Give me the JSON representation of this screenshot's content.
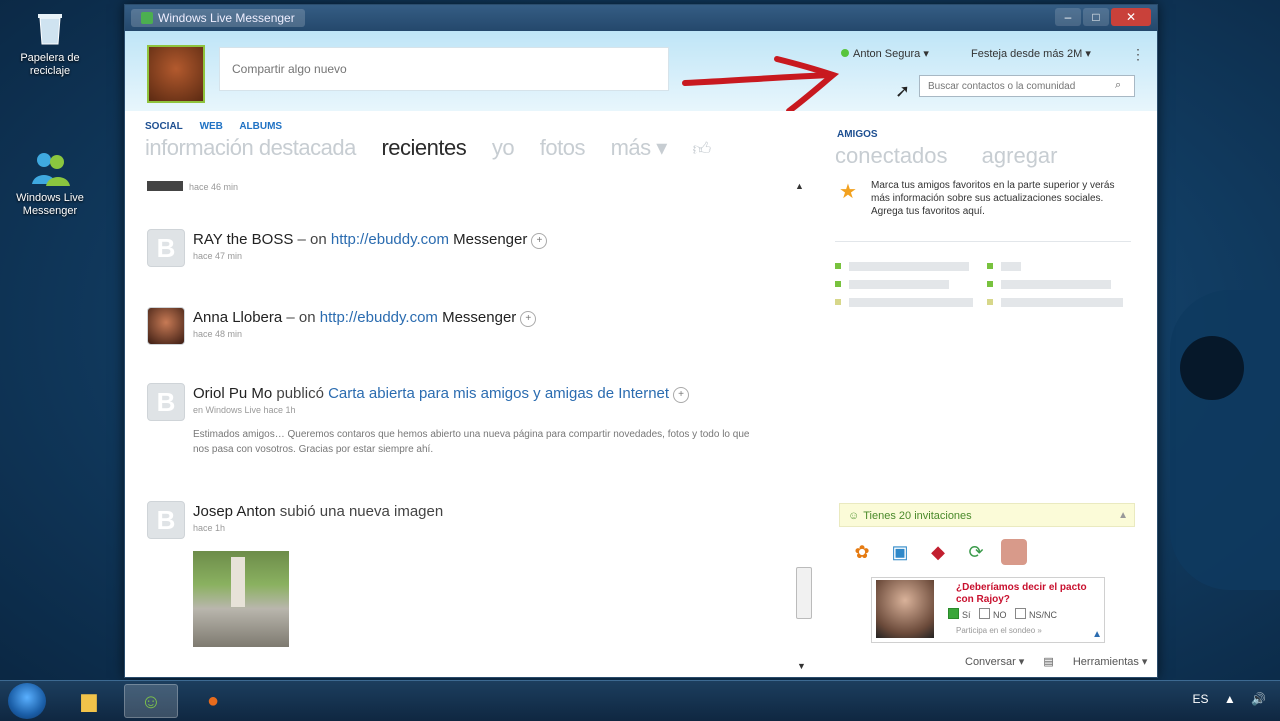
{
  "desktop": {
    "icons": [
      {
        "label": "Papelera de reciclaje"
      },
      {
        "label": "Windows Live Messenger"
      }
    ]
  },
  "window": {
    "title": "Windows Live Messenger",
    "minimize": "–",
    "maximize": "□",
    "close": "✕"
  },
  "header": {
    "share_placeholder": "Compartir algo nuevo",
    "status": "Anton Segura ▾",
    "mood": "Festeja desde más 2M ▾",
    "menu": "⋮",
    "search_placeholder": "Buscar contactos o la comunidad",
    "search_icon": "⌕"
  },
  "feed": {
    "subtabs": [
      "SOCIAL",
      "WEB",
      "ALBUMS"
    ],
    "tabs": [
      "información destacada",
      "recientes",
      "yo",
      "fotos",
      "más ▾"
    ],
    "active_tab": "recientes",
    "posts": [
      {
        "name": "RAY the BOSS",
        "connector": " – on ",
        "link": "http://ebuddy.com",
        "suffix": " Messenger",
        "time": "hace 47 min"
      },
      {
        "name": "Anna Llobera",
        "connector": " – on ",
        "link": "http://ebuddy.com",
        "suffix": " Messenger",
        "time": "hace 48 min"
      },
      {
        "name": "Oriol Pu Mo",
        "connector": " publicó ",
        "link": "Carta abierta para mis amigos y amigas de Internet",
        "suffix": "",
        "time": "en Windows Live hace 1h",
        "body": "Estimados amigos… Queremos contaros que hemos abierto una nueva página para compartir novedades, fotos y todo lo que nos pasa con vosotros. Gracias por estar siempre ahí."
      },
      {
        "name": "Josep Anton",
        "connector": " subió una nueva imagen",
        "link": "",
        "suffix": "",
        "time": "hace 1h"
      }
    ]
  },
  "side": {
    "section": "AMIGOS",
    "tabs": [
      "conectados",
      "agregar"
    ],
    "fav_tip": "Marca tus amigos favoritos en la parte superior y verás más información sobre sus actualizaciones sociales. Agrega tus favoritos aquí.",
    "invites": "Tienes 20 invitaciones",
    "ad": {
      "question": "¿Deberíamos decir el pacto con Rajoy?",
      "opt_yes": "Sí",
      "opt_no": "NO",
      "opt_ns": "NS/NC",
      "foot": "Participa en el sondeo »"
    },
    "footer_a": "Conversar ▾",
    "footer_b": "Herramientas ▾"
  },
  "taskbar": {
    "tray": "ES",
    "volume": "🔊",
    "flag": "▲"
  }
}
